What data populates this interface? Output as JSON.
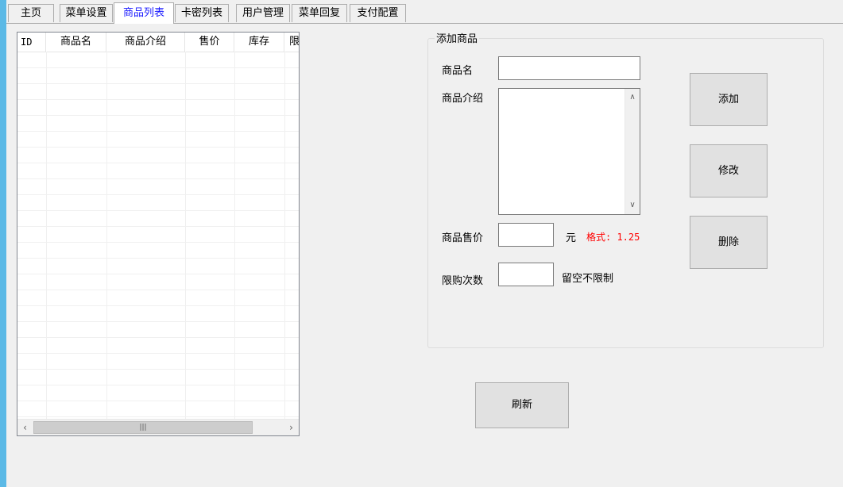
{
  "tabs": [
    {
      "label": "主页",
      "active": false
    },
    {
      "label": "菜单设置",
      "active": false
    },
    {
      "label": "商品列表",
      "active": true
    },
    {
      "label": "卡密列表",
      "active": false
    },
    {
      "label": "用户管理",
      "active": false
    },
    {
      "label": "菜单回复",
      "active": false
    },
    {
      "label": "支付配置",
      "active": false
    }
  ],
  "list": {
    "columns": [
      "ID",
      "商品名",
      "商品介绍",
      "售价",
      "库存",
      "限"
    ],
    "rows": []
  },
  "form": {
    "group_title": "添加商品",
    "name_label": "商品名",
    "name_value": "",
    "intro_label": "商品介绍",
    "intro_value": "",
    "price_label": "商品售价",
    "price_value": "",
    "price_unit": "元",
    "price_format": "格式: 1.25",
    "limit_label": "限购次数",
    "limit_value": "",
    "limit_hint": "留空不限制"
  },
  "buttons": {
    "add": "添加",
    "edit": "修改",
    "delete": "删除",
    "refresh": "刷新"
  },
  "colors": {
    "active_tab_text": "#1a1aff",
    "format_hint": "#ff0000",
    "window_border": "#5bb9e6"
  }
}
